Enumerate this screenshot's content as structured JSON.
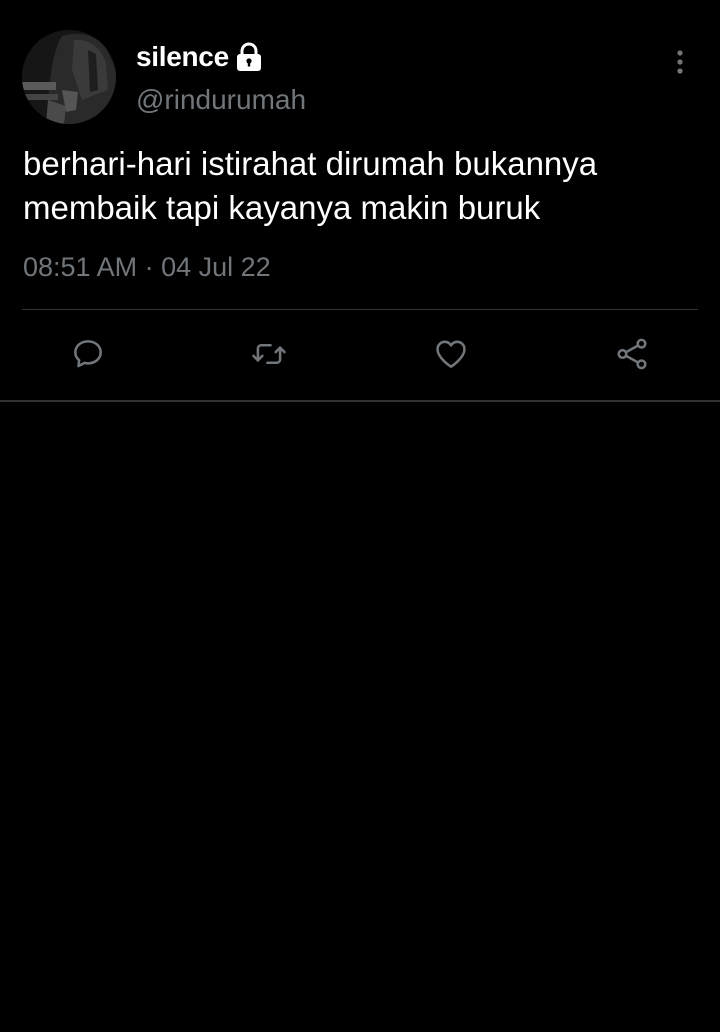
{
  "tweet": {
    "display_name": "silence",
    "handle": "@rindurumah",
    "text": "berhari-hari istirahat dirumah bukannya membaik tapi kayanya makin buruk",
    "timestamp": "08:51 AM · 04 Jul 22",
    "protected": true
  },
  "icons": {
    "lock": "lock-icon",
    "more": "more-vertical-icon",
    "reply": "reply-icon",
    "retweet": "retweet-icon",
    "like": "heart-icon",
    "share": "share-icon"
  },
  "colors": {
    "background": "#000000",
    "primary_text": "#ffffff",
    "secondary_text": "#71767b",
    "divider": "#2f3336"
  }
}
